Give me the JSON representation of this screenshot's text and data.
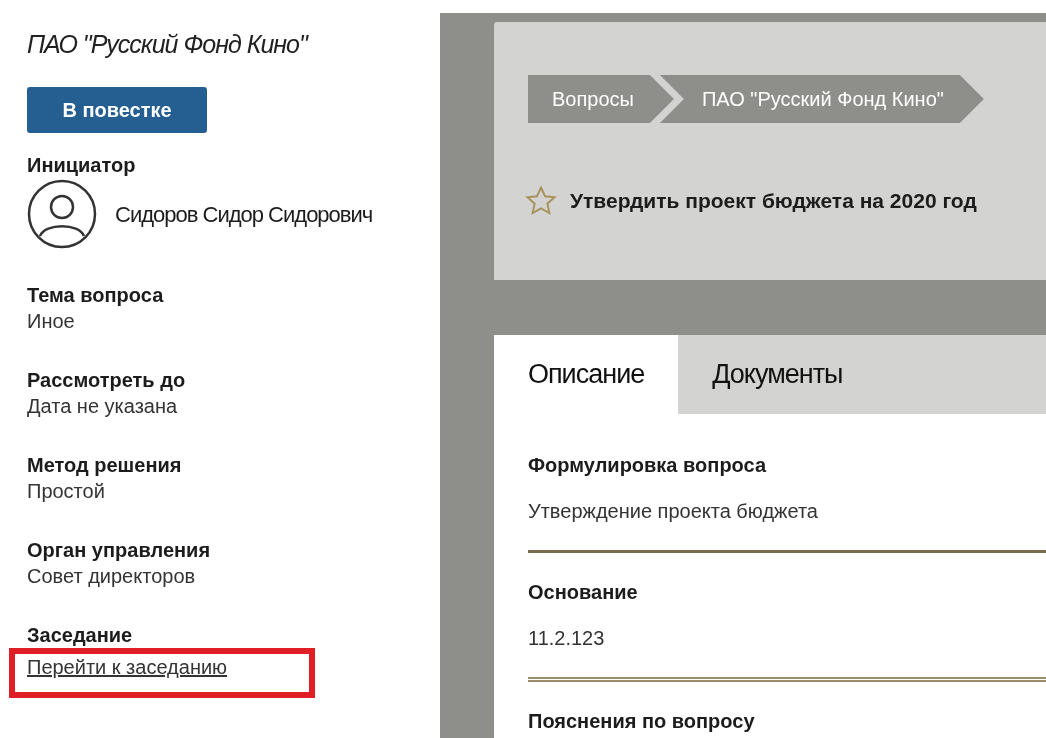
{
  "sidebar": {
    "company": "ПАО \"Русский Фонд Кино\"",
    "status_button": "В повестке",
    "initiator": {
      "label": "Инициатор",
      "name": "Сидоров Сидор Сидорович"
    },
    "fields": [
      {
        "label": "Тема вопроса",
        "value": "Иное"
      },
      {
        "label": "Рассмотреть до",
        "value": "Дата не указана"
      },
      {
        "label": "Метод решения",
        "value": "Простой"
      },
      {
        "label": "Орган управления",
        "value": "Совет директоров"
      }
    ],
    "meeting": {
      "label": "Заседание",
      "link": "Перейти к заседанию",
      "highlighted": true
    }
  },
  "breadcrumbs": [
    "Вопросы",
    "ПАО \"Русский Фонд Кино\""
  ],
  "question": {
    "title": "Утвердить проект бюджета на 2020 год",
    "starred": false
  },
  "tabs": [
    {
      "label": "Описание",
      "selected": true
    },
    {
      "label": "Документы",
      "selected": false
    }
  ],
  "sections": [
    {
      "label": "Формулировка вопроса",
      "value": "Утверждение проекта бюджета",
      "kind": "single_rule"
    },
    {
      "label": "Основание",
      "value": "11.2.123",
      "kind": "double_rule"
    },
    {
      "label": "Пояснения по вопросу"
    }
  ]
}
